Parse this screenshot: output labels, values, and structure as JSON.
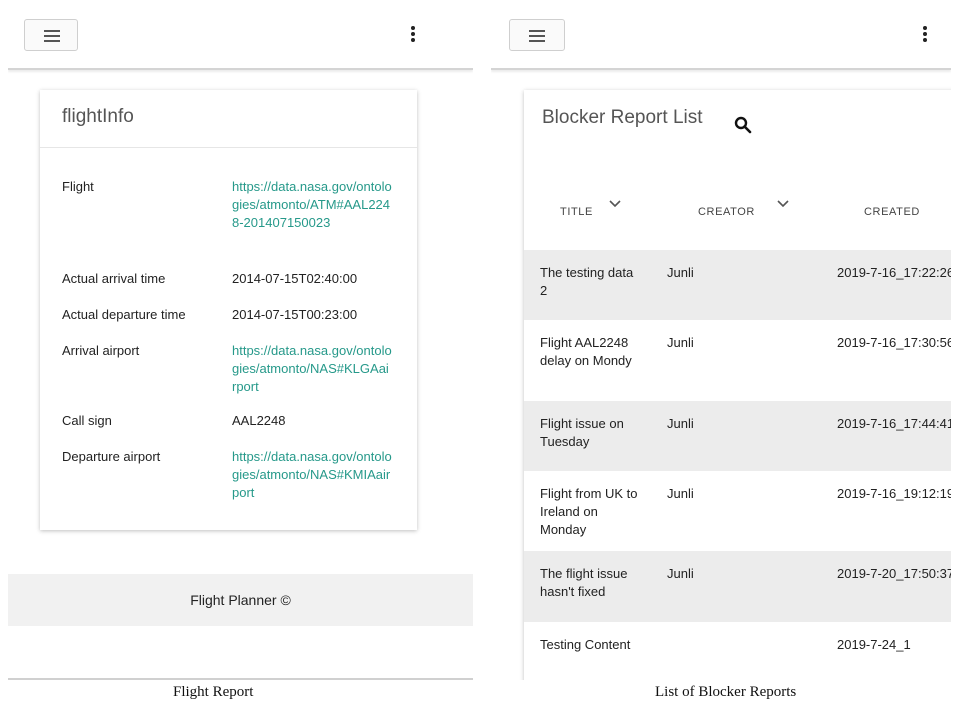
{
  "left_panel": {
    "card_title": "flightInfo",
    "fields": [
      {
        "label": "Flight",
        "value": "https://data.nasa.gov/ontologies/atmonto/ATM#AAL2248-201407150023",
        "link": true
      },
      {
        "label": "Actual arrival time",
        "value": "2014-07-15T02:40:00",
        "link": false
      },
      {
        "label": "Actual departure time",
        "value": "2014-07-15T00:23:00",
        "link": false
      },
      {
        "label": "Arrival airport",
        "value": "https://data.nasa.gov/ontologies/atmonto/NAS#KLGAairport",
        "link": true
      },
      {
        "label": "Call sign",
        "value": "AAL2248",
        "link": false
      },
      {
        "label": "Departure airport",
        "value": "https://data.nasa.gov/ontologies/atmonto/NAS#KMIAairport",
        "link": true
      }
    ],
    "footer": "Flight Planner ©"
  },
  "right_panel": {
    "list_title": "Blocker Report List",
    "columns": [
      "TITLE",
      "CREATOR",
      "CREATED"
    ],
    "rows": [
      {
        "title": "The testing data 2",
        "creator": "Junli",
        "created": "2019-7-16_17:22:26"
      },
      {
        "title": "Flight AAL2248 delay on Mondy",
        "creator": "Junli",
        "created": "2019-7-16_17:30:56"
      },
      {
        "title": "Flight issue on Tuesday",
        "creator": "Junli",
        "created": "2019-7-16_17:44:41"
      },
      {
        "title": "Flight from UK to Ireland on Monday",
        "creator": "Junli",
        "created": "2019-7-16_19:12:19"
      },
      {
        "title": "The flight issue hasn't fixed",
        "creator": "Junli",
        "created": "2019-7-20_17:50:37"
      },
      {
        "title": "Testing Content",
        "creator": "",
        "created": "2019-7-24_1"
      }
    ]
  },
  "captions": {
    "left": "Flight Report",
    "right": "List of Blocker Reports"
  },
  "colors": {
    "link": "#26998a",
    "row_shade": "#ececec",
    "footer_bg": "#f1f1f1"
  },
  "icons": [
    "menu-icon",
    "more-vert-icon",
    "search-icon",
    "chevron-down-icon"
  ]
}
